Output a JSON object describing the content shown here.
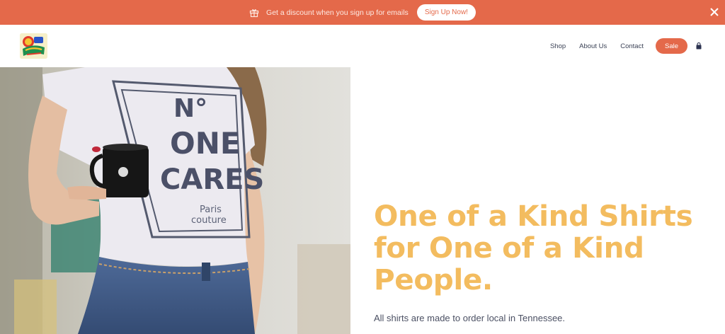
{
  "announcement": {
    "message": "Get a discount when you sign up for emails",
    "button_label": "Sign Up Now!",
    "icon": "gift-icon",
    "close_icon": "close-icon"
  },
  "header": {
    "logo_alt": "studio logo",
    "nav": {
      "shop": "Shop",
      "about": "About Us",
      "contact": "Contact",
      "sale": "Sale"
    },
    "cart_icon": "shopping-bag-icon"
  },
  "hero": {
    "image_subject": "woman in white t-shirt holding black mug",
    "shirt_text": {
      "line1": "N°",
      "line2": "ONE",
      "line3": "CARES",
      "line4": "Paris",
      "line5": "couture"
    },
    "headline": {
      "line1": "One of a Kind Shirts",
      "line2": "for One of a Kind",
      "line3": "People."
    },
    "subtext": "All shirts are made to order local in Tennessee."
  },
  "colors": {
    "accent": "#e4694a",
    "headline": "#f3bc5f",
    "nav_text": "#3b4256"
  }
}
